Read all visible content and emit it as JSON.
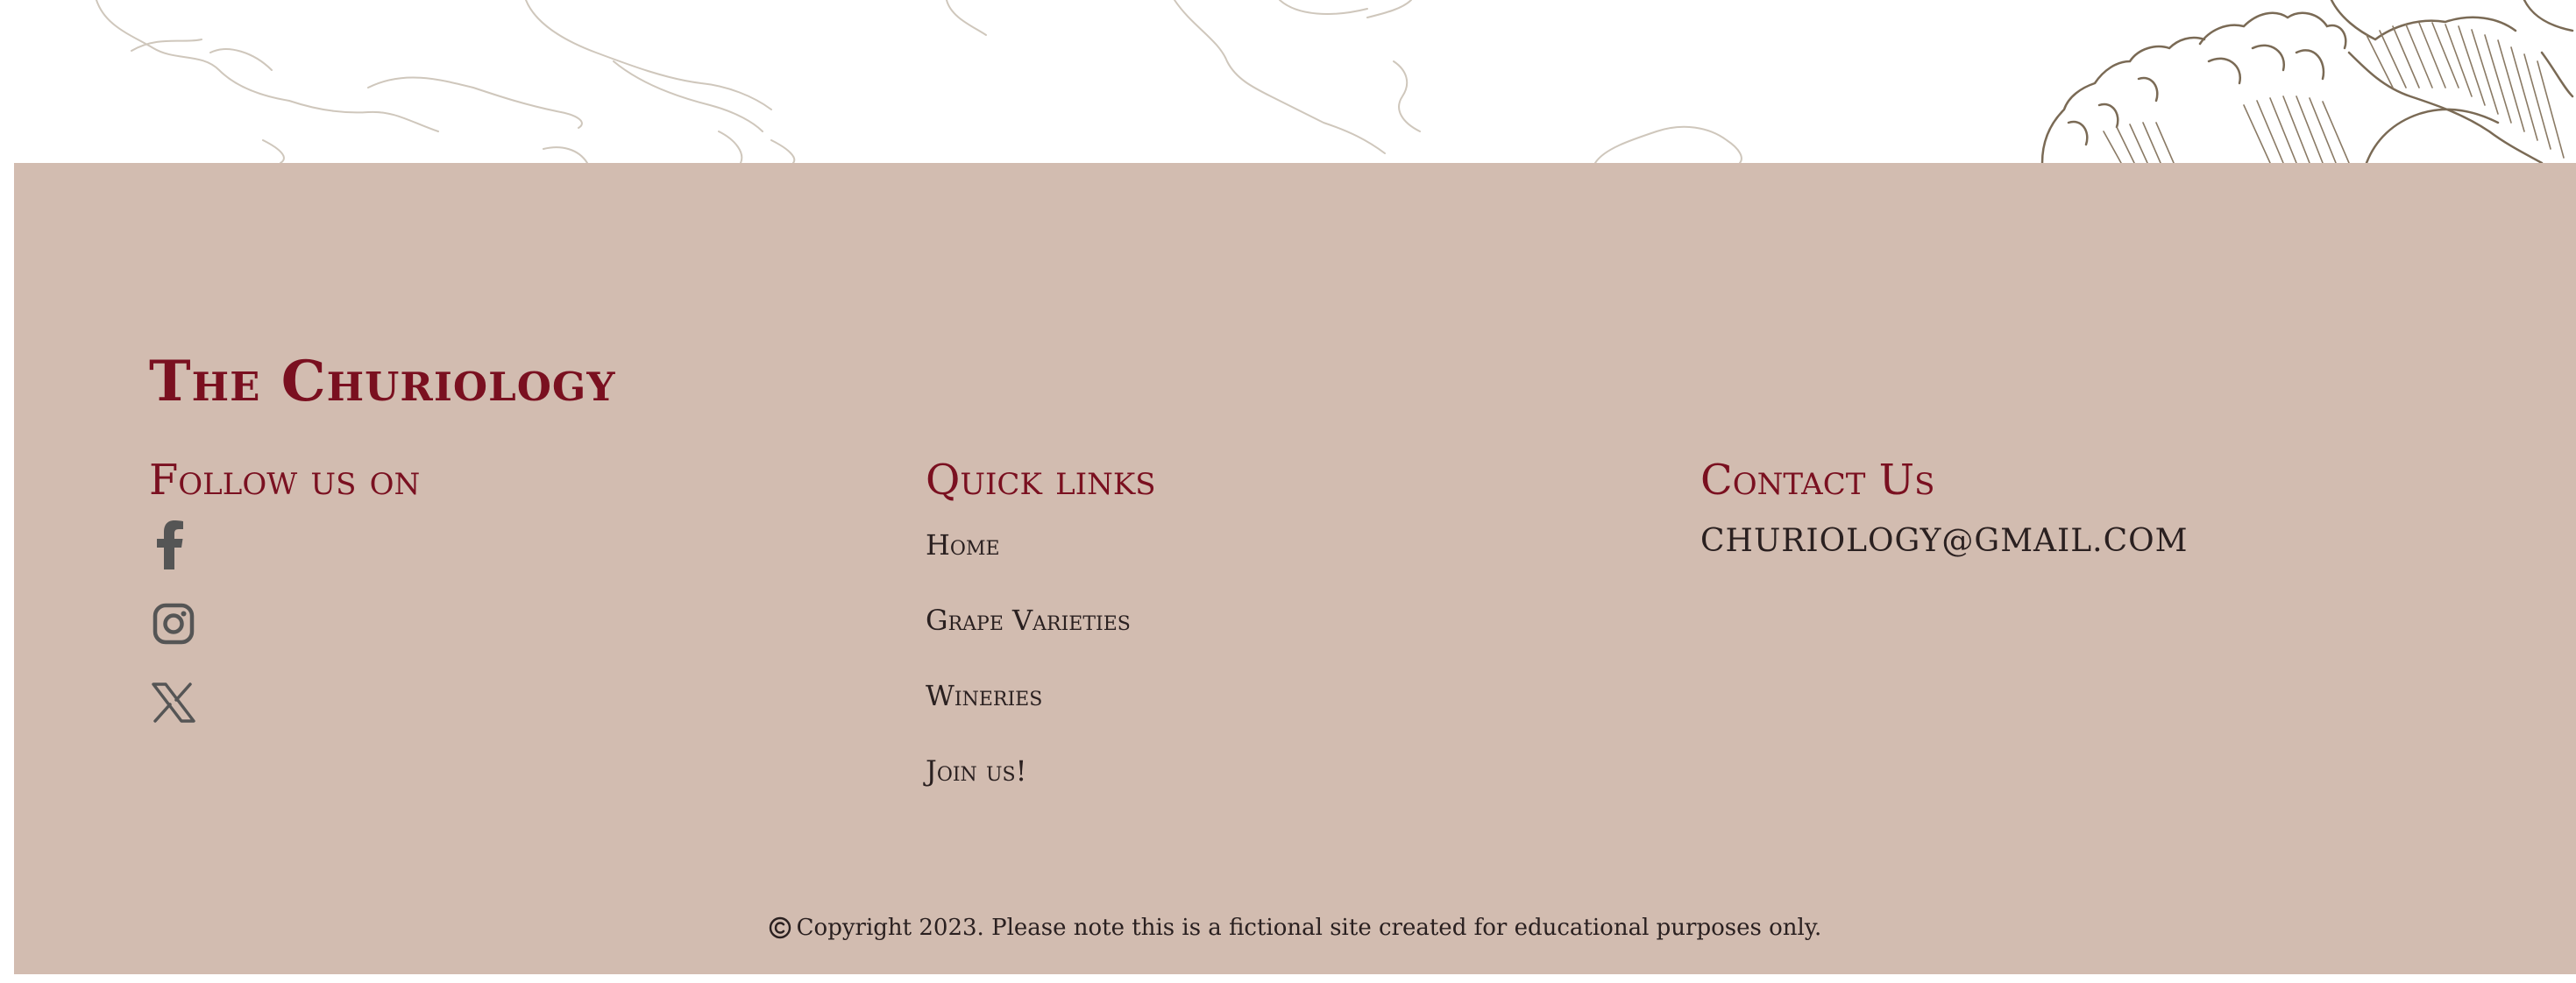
{
  "brand": {
    "name": "The Churiology"
  },
  "footer": {
    "background_color": "#d2bcb0",
    "accent_color": "#7a1020",
    "follow": {
      "heading": "Follow us on",
      "icons": [
        "facebook-icon",
        "instagram-icon",
        "x-icon"
      ]
    },
    "quick_links": {
      "heading": "Quick links",
      "items": [
        {
          "label": "Home"
        },
        {
          "label": "Grape Varieties"
        },
        {
          "label": "Wineries"
        },
        {
          "label": "Join us!"
        }
      ]
    },
    "contact": {
      "heading": "Contact Us",
      "email": "CHURIOLOGY@GMAIL.COM"
    },
    "copyright": {
      "icon": "copyright-icon",
      "text": "Copyright 2023. Please note this is a fictional site created for educational purposes only."
    }
  }
}
